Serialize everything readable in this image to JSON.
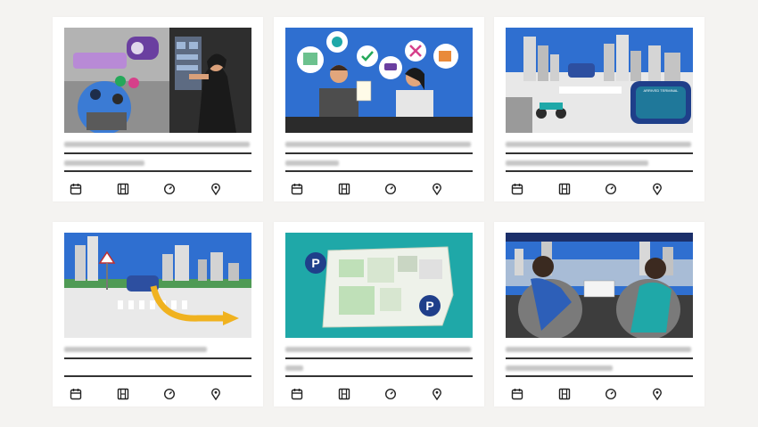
{
  "cards": [
    {
      "title_line1": "",
      "title_line2": "",
      "actions": {
        "calendar": "calendar-icon",
        "video": "film-icon",
        "duration": "clock-icon",
        "location": "pin-icon"
      }
    },
    {
      "title_line1": "",
      "title_line2": "",
      "actions": {
        "calendar": "calendar-icon",
        "video": "film-icon",
        "duration": "clock-icon",
        "location": "pin-icon"
      }
    },
    {
      "title_line1": "",
      "title_line2": "",
      "actions": {
        "calendar": "calendar-icon",
        "video": "film-icon",
        "duration": "clock-icon",
        "location": "pin-icon"
      }
    },
    {
      "title_line1": "",
      "title_line2": "",
      "actions": {
        "calendar": "calendar-icon",
        "video": "film-icon",
        "duration": "clock-icon",
        "location": "pin-icon"
      }
    },
    {
      "title_line1": "",
      "title_line2": "",
      "actions": {
        "calendar": "calendar-icon",
        "video": "film-icon",
        "duration": "clock-icon",
        "location": "pin-icon"
      }
    },
    {
      "title_line1": "",
      "title_line2": "",
      "actions": {
        "calendar": "calendar-icon",
        "video": "film-icon",
        "duration": "clock-icon",
        "location": "pin-icon"
      }
    }
  ],
  "illustrations": {
    "card1": {
      "sign_text": ""
    },
    "card3": {
      "sign_text": "ARRIVED TERMINAL"
    },
    "colors": {
      "sky_blue": "#2f6fd0",
      "teal": "#1fa8a8",
      "accent_yellow": "#f0b21f",
      "accent_purple": "#6a3fa0",
      "dark_gray": "#4b4b4b",
      "rule": "#333333",
      "page_bg": "#f4f3f1"
    }
  }
}
